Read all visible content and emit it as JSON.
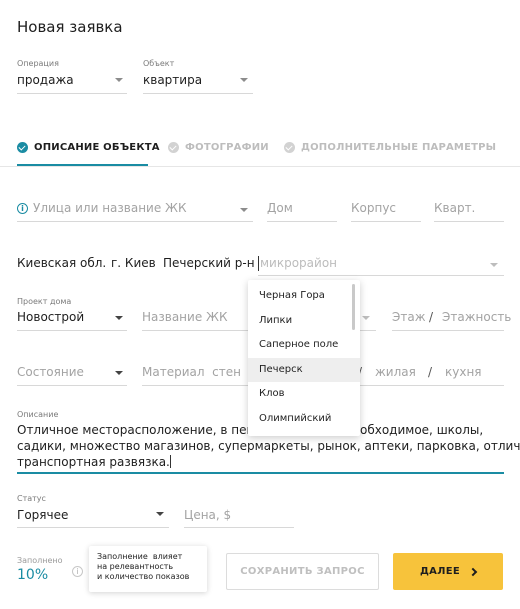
{
  "page": {
    "title": "Новая заявка"
  },
  "operation": {
    "label": "Операция",
    "value": "продажа"
  },
  "object": {
    "label": "Объект",
    "value": "квартира"
  },
  "tabs": [
    {
      "label": "ОПИСАНИЕ ОБЪЕКТА",
      "active": true
    },
    {
      "label": "ФОТОГРАФИИ",
      "active": false
    },
    {
      "label": "ДОПОЛНИТЕЛЬНЫЕ ПАРАМЕТРЫ",
      "active": false
    }
  ],
  "address": {
    "street_placeholder": "Улица или название ЖК",
    "house_placeholder": "Дом",
    "building_placeholder": "Корпус",
    "apt_placeholder": "Кварт."
  },
  "location": {
    "region": "Киевская обл.",
    "city": "г. Киев",
    "district": "Печерский р-н",
    "microdistrict_placeholder": "микрорайон"
  },
  "microdistrict_options": [
    "Черная Гора",
    "Липки",
    "Саперное поле",
    "Печерск",
    "Клов",
    "Олимпийский"
  ],
  "microdistrict_highlighted": "Печерск",
  "project": {
    "label": "Проект дома",
    "value": "Новострой",
    "complex_placeholder": "Название ЖК",
    "floor_placeholder": "Этаж",
    "floors_placeholder": "Этажность"
  },
  "condition": {
    "placeholder": "Состояние",
    "wall_material_placeholder": "Материал  стен",
    "living_placeholder": "жилая",
    "kitchen_placeholder": "кухня"
  },
  "description": {
    "label": "Описание",
    "line1_a": "Отличное месторасположение, в пешей",
    "line1_b": "обходимое, школы,",
    "line2": "садики, множество магазинов, супермаркеты, рынок, аптеки, парковка, отличная",
    "line3": "транспортная развязка."
  },
  "status": {
    "label": "Статус",
    "value": "Горячее"
  },
  "price": {
    "placeholder": "Цена, $"
  },
  "filled": {
    "label": "Заполнено",
    "value": "10%"
  },
  "tooltip": {
    "line1": "Заполнение  влияет",
    "line2": "на релевантность",
    "line3": "и количество показов"
  },
  "buttons": {
    "save": "СОХРАНИТЬ ЗАПРОС",
    "next": "ДАЛЕЕ"
  },
  "colors": {
    "accent": "#1a8ca3",
    "primary": "#f7c33b",
    "tab_inactive": "#c8c8c8"
  }
}
